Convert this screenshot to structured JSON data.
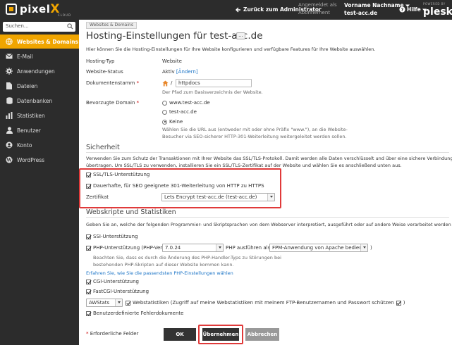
{
  "topbar": {
    "brand": "pixel",
    "brand_x": "X",
    "brand_sub": "CLOUD",
    "back": "Zurück zum Administrator",
    "logged_in_label": "Angemeldet als",
    "user_name": "Vorname Nachname",
    "subscription_label": "Abonnement",
    "subscription": "test-acc.de",
    "help": "Hilfe",
    "powered_by": "POWERED BY",
    "plesk": "plesk"
  },
  "sidebar": {
    "search_placeholder": "Suchen...",
    "items": [
      {
        "label": "Websites & Domains",
        "icon": "globe-icon"
      },
      {
        "label": "E-Mail",
        "icon": "mail-icon"
      },
      {
        "label": "Anwendungen",
        "icon": "gear-icon"
      },
      {
        "label": "Dateien",
        "icon": "file-icon"
      },
      {
        "label": "Datenbanken",
        "icon": "database-icon"
      },
      {
        "label": "Statistiken",
        "icon": "chart-icon"
      },
      {
        "label": "Benutzer",
        "icon": "user-icon"
      },
      {
        "label": "Konto",
        "icon": "account-icon"
      },
      {
        "label": "WordPress",
        "icon": "wordpress-icon"
      }
    ]
  },
  "main": {
    "breadcrumb": "Websites & Domains",
    "title": "Hosting-Einstellungen für test-acc.de",
    "more": "...",
    "intro": "Hier können Sie die Hosting-Einstellungen für Ihre Website konfigurieren und verfügbare Features für Ihre Website auswählen.",
    "hosting_type_label": "Hosting-Typ",
    "hosting_type": "Website",
    "site_status_label": "Website-Status",
    "site_status": "Aktiv",
    "site_status_link": "[Ändern]",
    "docroot_label": "Dokumentenstamm",
    "docroot_slash": "/",
    "docroot_value": "httpdocs",
    "docroot_hint": "Der Pfad zum Basisverzeichnis der Website.",
    "pref_domain_label": "Bevorzugte Domain",
    "pref_options": [
      "www.test-acc.de",
      "test-acc.de",
      "Keine"
    ],
    "pref_hint_1": "Wählen Sie die URL aus (entweder mit oder ohne Präfix \"www.\"), an die Website-",
    "pref_hint_2": "Besucher via SEO-sicherer HTTP-301-Weiterleitung weitergeleitet werden sollen.",
    "security_title": "Sicherheit",
    "security_text_1": "Verwenden Sie zum Schutz der Transaktionen mit Ihrer Website das SSL/TLS-Protokoll. Damit werden alle Daten verschlüsselt und über eine sichere Verbindung",
    "security_text_2": "übertragen. Um SSL/TLS zu verwenden, installieren Sie ein SSL/TLS-Zertifikat auf der Website und wählen Sie es anschließend unten aus.",
    "ssl_label": "SSL/TLS-Unterstützung",
    "redirect_label": "Dauerhafte, für SEO geeignete 301-Weiterleitung von HTTP zu HTTPS",
    "cert_label": "Zertifikat",
    "cert_value": "Lets Encrypt test-acc.de (test-acc.de)",
    "scripts_title": "Webskripte und Statistiken",
    "scripts_text": "Geben Sie an, welche der folgenden Programmier- und Skriptsprachen von dem Webserver interpretiert, ausgeführt oder auf andere Weise verarbeitet werden sollen.",
    "ssi_label": "SSI-Unterstützung",
    "php_label": "PHP-Unterstützung (PHP-Version",
    "php_version": "7.0.24",
    "php_run_label": "PHP ausführen als",
    "php_handler": "FPM-Anwendung von Apache bedient",
    "php_close": ")",
    "php_hint_1": "Beachten Sie, dass es durch die Änderung des PHP-Handler-Typs zu Störungen bei",
    "php_hint_2": "bestehenden PHP-Skripten auf dieser Website kommen kann.",
    "php_link": "Erfahren Sie, wie Sie die passendsten PHP-Einstellungen wählen",
    "cgi_label": "CGI-Unterstützung",
    "fastcgi_label": "FastCGI-Unterstützung",
    "stats_value": "AWStats",
    "stats_label": "Webstatistiken (Zugriff auf meine Webstatistiken mit meinem FTP-Benutzernamen und Passwort schützen",
    "stats_close": ")",
    "errordocs_label": "Benutzerdefinierte Fehlerdokumente",
    "required_note": "Erforderliche Felder",
    "ok": "OK",
    "apply": "Übernehmen",
    "cancel": "Abbrechen"
  },
  "colors": {
    "accent": "#f0a500",
    "highlight": "#e03a3a",
    "link": "#1a73c6"
  }
}
